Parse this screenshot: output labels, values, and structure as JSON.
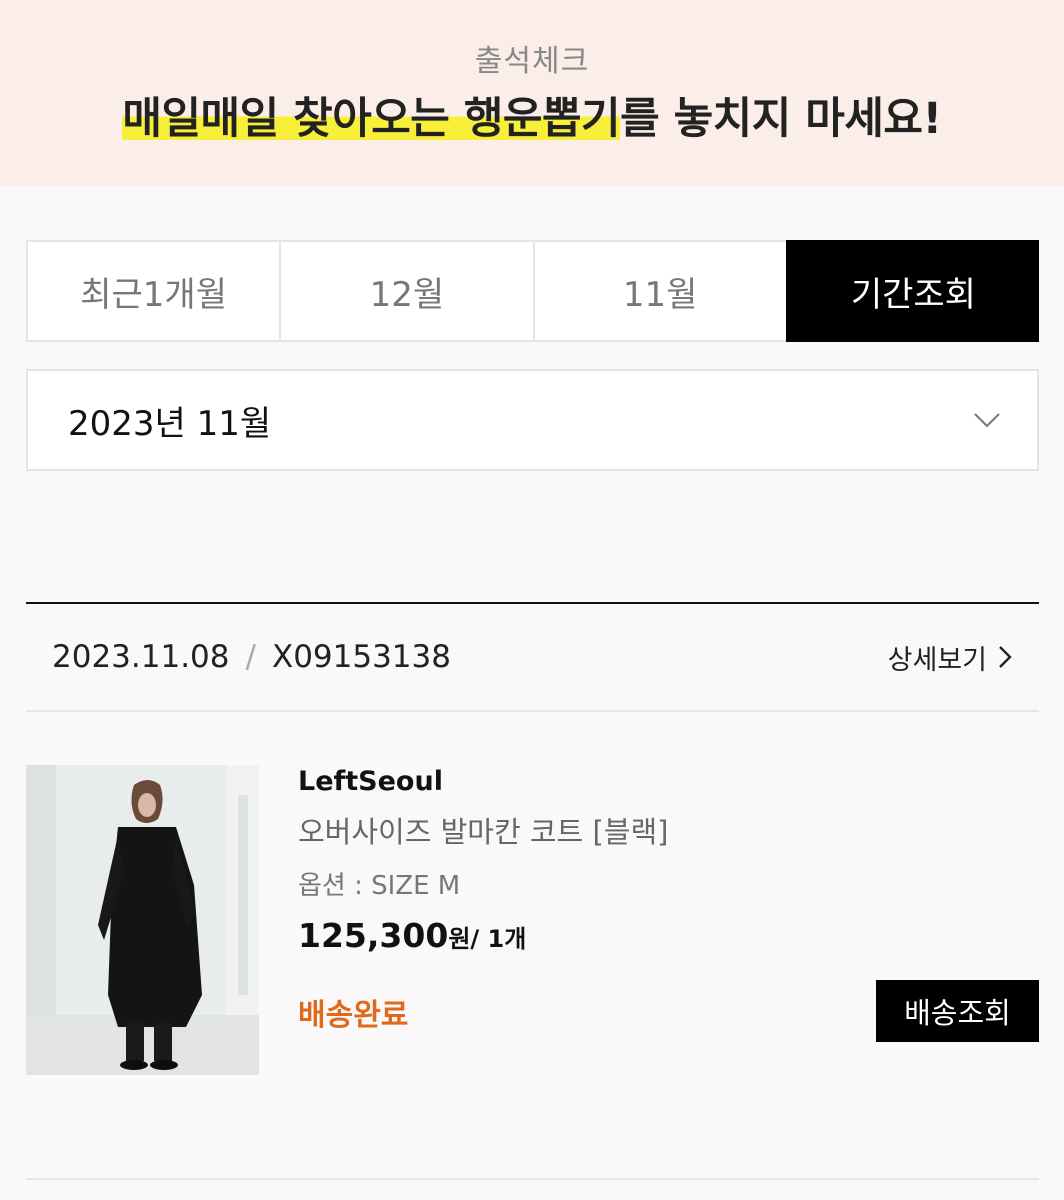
{
  "banner": {
    "subtitle": "출석체크",
    "headline_highlight": "매일매일 찾아오는 행운뽑기",
    "headline_rest": "를 놓치지 마세요!"
  },
  "period_tabs": [
    {
      "label": "최근1개월",
      "active": false
    },
    {
      "label": "12월",
      "active": false
    },
    {
      "label": "11월",
      "active": false
    },
    {
      "label": "기간조회",
      "active": true
    }
  ],
  "month_select": {
    "value": "2023년 11월",
    "icon": "chevron-down-icon"
  },
  "order": {
    "date": "2023.11.08",
    "separator": "/",
    "number": "X09153138",
    "detail_label": "상세보기",
    "detail_icon": "chevron-right-icon"
  },
  "product": {
    "brand": "LeftSeoul",
    "name": "오버사이즈 발마칸 코트 [블랙]",
    "option": "옵션 : SIZE M",
    "price": "125,300",
    "price_unit": "원",
    "quantity": "/ 1개",
    "status": "배송완료",
    "status_color": "#e06a1c",
    "track_button": "배송조회"
  },
  "colors": {
    "banner_bg": "#fbeee8",
    "highlight": "#f8ef3a",
    "active_tab_bg": "#000000"
  }
}
